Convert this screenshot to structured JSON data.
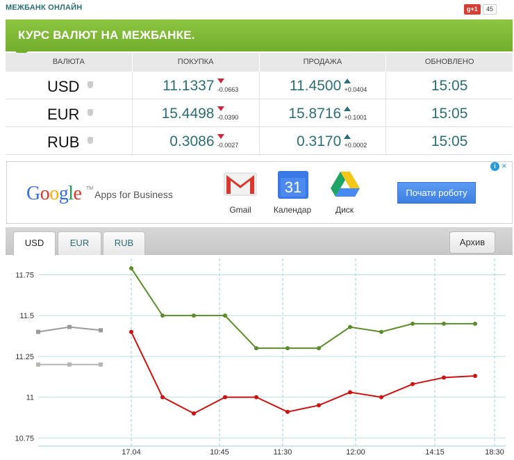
{
  "app_title": "МЕЖБАНК ОНЛАЙН",
  "gplus": {
    "label": "g+1",
    "count": "45"
  },
  "banner_title": "КУРС ВАЛЮТ НА МЕЖБАНКЕ.",
  "table": {
    "headers": [
      "ВАЛЮТА",
      "ПОКУПКА",
      "ПРОДАЖА",
      "ОБНОВЛЕНО"
    ],
    "rows": [
      {
        "code": "USD",
        "buy": "11.1337",
        "buy_delta": "-0.0663",
        "buy_dir": "down",
        "sell": "11.4500",
        "sell_delta": "+0.0404",
        "sell_dir": "up",
        "updated": "15:05"
      },
      {
        "code": "EUR",
        "buy": "15.4498",
        "buy_delta": "-0.0390",
        "buy_dir": "down",
        "sell": "15.8716",
        "sell_delta": "+0.1001",
        "sell_dir": "up",
        "updated": "15:05"
      },
      {
        "code": "RUB",
        "buy": "0.3086",
        "buy_delta": "-0.0027",
        "buy_dir": "down",
        "sell": "0.3170",
        "sell_delta": "+0.0002",
        "sell_dir": "up",
        "updated": "15:05"
      }
    ]
  },
  "ad": {
    "logo": [
      "G",
      "o",
      "o",
      "g",
      "l",
      "e"
    ],
    "logo_tm": "TM",
    "tagline": "Apps for Business",
    "products": [
      "Gmail",
      "Календар",
      "Диск"
    ],
    "calendar_day": "31",
    "cta": "Почати роботу",
    "info_icon": "i",
    "close_icon": "×"
  },
  "tabs": [
    "USD",
    "EUR",
    "RUB"
  ],
  "active_tab": "USD",
  "archive_label": "Архив",
  "colors": {
    "green": "#5a8c2a",
    "red": "#cc1111",
    "gray": "#a0a0a0",
    "accent": "#2c6e73",
    "banner": "#7cb633"
  },
  "chart_data": {
    "type": "line",
    "ylim": [
      10.7,
      11.85
    ],
    "yticks": [
      10.75,
      11,
      11.25,
      11.5,
      11.75
    ],
    "ytick_labels": [
      "10.75",
      "11",
      "11.25",
      "11.5",
      "11.75"
    ],
    "xticks": [
      "17.04",
      "10:45",
      "11:30",
      "12:00",
      "14:15",
      "18:30"
    ],
    "series": [
      {
        "color": "green",
        "values": [
          11.79,
          11.5,
          11.5,
          11.5,
          11.3,
          11.3,
          11.3,
          11.43,
          11.4,
          11.45,
          11.45,
          11.45
        ]
      },
      {
        "color": "red",
        "values": [
          11.4,
          11.0,
          10.9,
          11.0,
          11.0,
          10.91,
          10.95,
          11.03,
          11.0,
          11.08,
          11.12,
          11.13
        ]
      },
      {
        "color": "gray",
        "values": [
          11.4,
          11.43,
          11.41
        ]
      },
      {
        "color": "gray-light",
        "values": [
          11.2,
          11.2,
          11.2
        ]
      }
    ]
  }
}
